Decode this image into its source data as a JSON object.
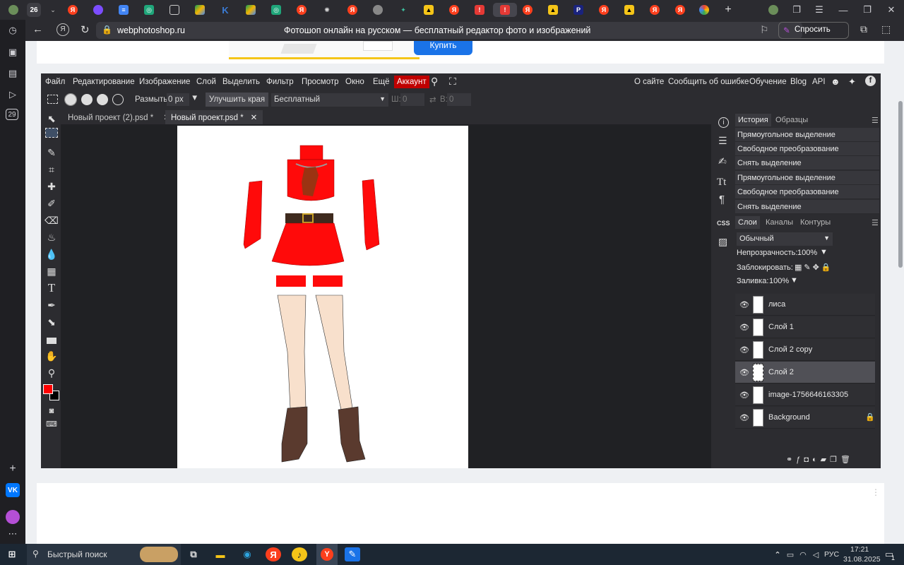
{
  "browser": {
    "tab_count_badge": "26",
    "page_title": "Фотошоп онлайн на русском — бесплатный редактор фото и изображений",
    "url": "webphotoshop.ru",
    "ask_button": "Спросить",
    "rail_badge": "29"
  },
  "ad": {
    "buy_button": "Купить"
  },
  "menu": {
    "items": [
      "Файл",
      "Редактирование",
      "Изображение",
      "Слой",
      "Выделить",
      "Фильтр",
      "Просмотр",
      "Окно",
      "Ещё"
    ],
    "account": "Аккаунт",
    "right_items": [
      "О сайте",
      "Сообщить об ошибке",
      "Обучение",
      "Blog",
      "API"
    ]
  },
  "options": {
    "feather_label": "Размыть:",
    "feather_value": "0 px",
    "refine_edge": "Улучшить края",
    "style_value": "Бесплатный",
    "w_label": "Ш:",
    "w_value": "0",
    "h_label": "В:",
    "h_value": "0"
  },
  "doc_tabs": [
    "Новый проект (2).psd *",
    "Новый проект.psd *"
  ],
  "history": {
    "tabs": [
      "История",
      "Образцы"
    ],
    "entries": [
      "Прямоугольное выделение",
      "Свободное преобразование",
      "Снять выделение",
      "Прямоугольное выделение",
      "Свободное преобразование",
      "Снять выделение"
    ]
  },
  "layers": {
    "tabs": [
      "Слои",
      "Каналы",
      "Контуры"
    ],
    "blend_mode": "Обычный",
    "opacity_label": "Непрозрачность:",
    "opacity_value": "100%",
    "lock_label": "Заблокировать:",
    "fill_label": "Заливка:",
    "fill_value": "100%",
    "items": [
      "лиса",
      "Слой 1",
      "Слой 2 copy",
      "Слой 2",
      "image-1756646163305",
      "Background"
    ],
    "selected": "Слой 2"
  },
  "side_panel": {
    "css_label": "CSS"
  },
  "taskbar": {
    "search_placeholder": "Быстрый поиск",
    "lang": "РУС",
    "time": "17:21",
    "date": "31.08.2025",
    "notif_count": "1"
  },
  "colors": {
    "accent_red": "#c00000",
    "foreground_color": "#ff0000",
    "background_color": "#000000",
    "buy_blue": "#1a73e8"
  }
}
